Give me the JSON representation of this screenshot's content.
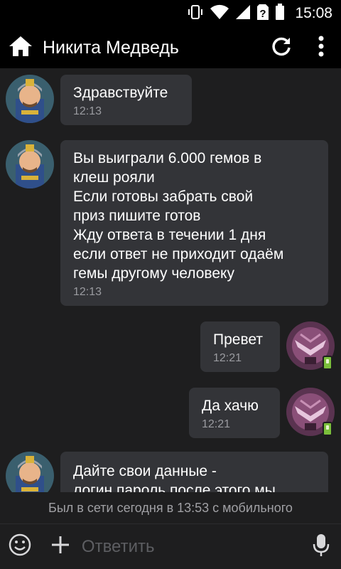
{
  "status_bar": {
    "time": "15:08",
    "icons": [
      "vibrate-icon",
      "wifi-icon",
      "signal-icon",
      "no-sim-icon",
      "battery-icon"
    ]
  },
  "header": {
    "title": "Никита Медведь",
    "icons": [
      "home-icon",
      "refresh-icon",
      "more-vert-icon"
    ]
  },
  "messages": [
    {
      "direction": "incoming",
      "text": "Здравствуйте",
      "time": "12:13"
    },
    {
      "direction": "incoming",
      "text": "Вы выиграли 6.000 гемов в\nклеш рояли\nЕсли готовы забрать свой\nприз пишите готов\nЖду ответа в течении 1 дня\nесли ответ не приходит одаём\nгемы другому человеку",
      "time": "12:13"
    },
    {
      "direction": "outgoing",
      "text": "Превет",
      "time": "12:21"
    },
    {
      "direction": "outgoing",
      "text": "Да хачю",
      "time": "12:21"
    },
    {
      "direction": "incoming",
      "text": "Дайте свои данные -\nлогин пароль после этого мы",
      "time": ""
    }
  ],
  "last_seen": "Был в сети сегодня в 13:53 с мобильного",
  "composer": {
    "placeholder": "Ответить",
    "icons": [
      "emoji-icon",
      "attach-plus-icon",
      "microphone-icon"
    ]
  },
  "colors": {
    "background": "#1e1e1f",
    "bar": "#000000",
    "bubble": "#333438",
    "timestamp": "#9a9ba0",
    "online_badge": "#7bbf3b"
  }
}
